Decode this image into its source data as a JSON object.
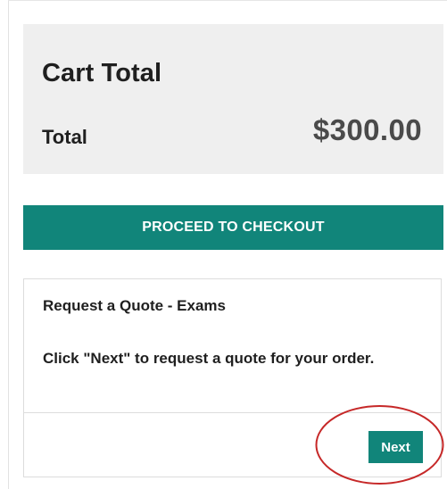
{
  "cart_total": {
    "title": "Cart Total",
    "total_label": "Total",
    "total_value": "$300.00"
  },
  "checkout": {
    "button_label": "PROCEED TO CHECKOUT"
  },
  "quote": {
    "title": "Request a Quote - Exams",
    "message": "Click \"Next\" to request a quote for your order.",
    "next_label": "Next"
  },
  "colors": {
    "accent": "#11857a",
    "panel_bg": "#efefef",
    "annotation": "#c62828"
  }
}
